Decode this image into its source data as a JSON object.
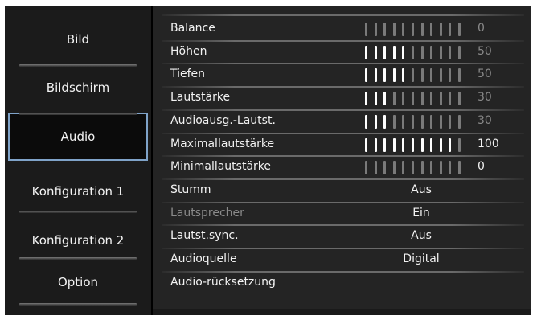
{
  "nav": {
    "items": [
      {
        "label": "Bild",
        "selected": false
      },
      {
        "label": "Bildschirm",
        "selected": false
      },
      {
        "label": "Audio",
        "selected": true
      },
      {
        "label": "Konfiguration 1",
        "selected": false
      },
      {
        "label": "Konfiguration 2",
        "selected": false
      },
      {
        "label": "Option",
        "selected": false
      }
    ]
  },
  "settings": [
    {
      "label": "Balance",
      "type": "slider",
      "value": "0",
      "level": 0.0,
      "dim": true
    },
    {
      "label": "Höhen",
      "type": "slider",
      "value": "50",
      "level": 0.5,
      "dim": true
    },
    {
      "label": "Tiefen",
      "type": "slider",
      "value": "50",
      "level": 0.5,
      "dim": true
    },
    {
      "label": "Lautstärke",
      "type": "slider",
      "value": "30",
      "level": 0.3,
      "dim": true
    },
    {
      "label": "Audioausg.-Lautst.",
      "type": "slider",
      "value": "30",
      "level": 0.3,
      "dim": true
    },
    {
      "label": "Maximallautstärke",
      "type": "slider",
      "value": "100",
      "level": 1.0,
      "dim": false
    },
    {
      "label": "Minimallautstärke",
      "type": "slider",
      "value": "0",
      "level": 0.0,
      "dim": false
    },
    {
      "label": "Stumm",
      "type": "option",
      "value": "Aus"
    },
    {
      "label": "Lautsprecher",
      "type": "option",
      "value": "Ein",
      "label_dim": true
    },
    {
      "label": "Lautst.sync.",
      "type": "option",
      "value": "Aus"
    },
    {
      "label": "Audioquelle",
      "type": "option",
      "value": "Digital"
    },
    {
      "label": "Audio-rücksetzung",
      "type": "action",
      "value": ""
    }
  ],
  "colors": {
    "bar_filled": "#ffffff",
    "bar_empty": "#7a7a7a",
    "text": "#f2f2f2",
    "dim_text": "#8a8a8a",
    "selection_border": "#7fa3c9"
  }
}
